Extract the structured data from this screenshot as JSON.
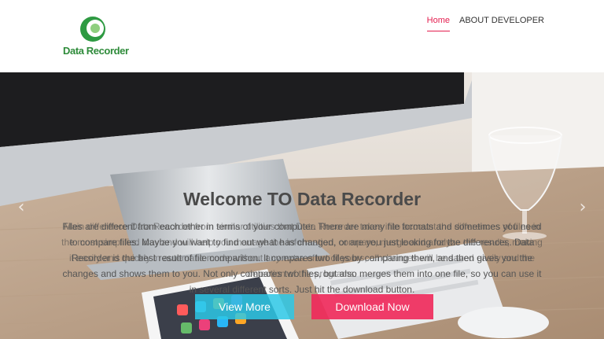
{
  "brand": {
    "name": "Data Recorder",
    "color": "#2e8b3a"
  },
  "nav": {
    "items": [
      {
        "label": "Home",
        "active": true
      },
      {
        "label": "ABOUT DEVELOPER",
        "active": false
      }
    ],
    "accent": "#e41e4f"
  },
  "hero": {
    "title": "Welcome TO Data Recorder",
    "text_primary": "Files are different from each other in terms of your computer. There are many file formats and sometimes you need to compare files. Maybe you want to find out what has changed, or are you just looking for the differences. Data Recorder is the best result of file comparison. It compares two files by comparing them, and then gives you the changes and shows them to you. Not only compares two files, but also merges them into one file, so you can use it in several different sorts. Just hit the download button.",
    "text_ghost": "Main difference Data Recorder from similar utilities that Data Recorder takes into account the differences of files in the most simplified way and will help you manage the information, compare, merge and analyze the results, making it easily and quickly in automatic mode without any extra effort of yours, all changes will be saved easily and the detection of the programs.",
    "view_more_label": "View More",
    "download_label": "Download Now",
    "view_more_color": "#2dc8e6",
    "download_color": "#f0285a",
    "prev_icon": "chevron-left-icon",
    "next_icon": "chevron-right-icon"
  }
}
